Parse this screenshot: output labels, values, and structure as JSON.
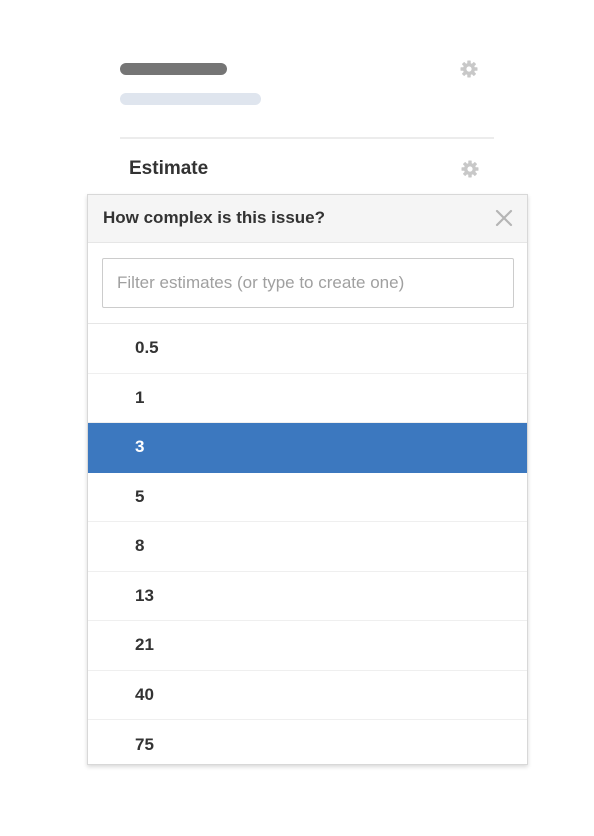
{
  "sidebar_section": {
    "title": "Estimate"
  },
  "dropdown": {
    "title": "How complex is this issue?",
    "filter_placeholder": "Filter estimates (or type to create one)",
    "filter_value": "",
    "options": [
      "0.5",
      "1",
      "3",
      "5",
      "8",
      "13",
      "21",
      "40",
      "75"
    ],
    "selected_value": "3"
  },
  "icons": {
    "settings_top": "gear-icon",
    "settings_estimate": "gear-icon",
    "close": "close-icon"
  },
  "colors": {
    "selected_bg": "#3c78bf",
    "selected_text": "#ffffff",
    "placeholder_dark": "#757575",
    "placeholder_light": "#dfe5ee"
  }
}
